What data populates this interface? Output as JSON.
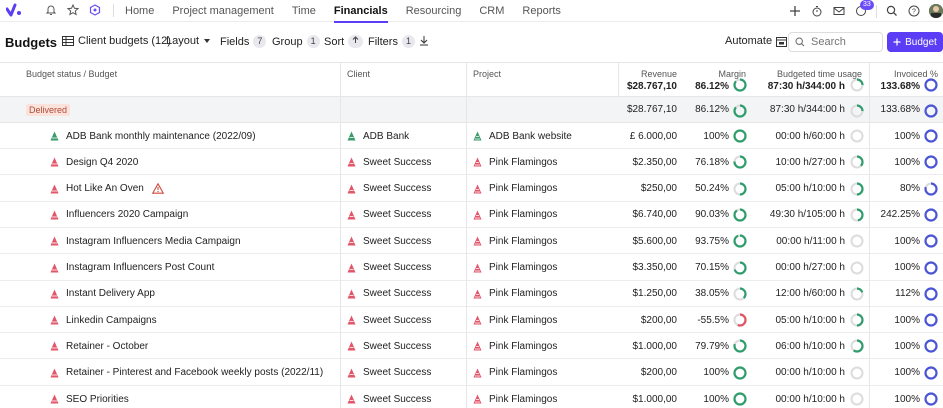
{
  "nav": {
    "items": [
      "Home",
      "Project management",
      "Time",
      "Financials",
      "Resourcing",
      "CRM",
      "Reports"
    ],
    "notification_count": "33"
  },
  "toolbar": {
    "title": "Budgets",
    "client_budgets": "Client budgets (12)",
    "layout": "Layout",
    "fields": "Fields",
    "fields_count": "7",
    "group": "Group",
    "group_count": "1",
    "sort": "Sort",
    "filters": "Filters",
    "filters_count": "1",
    "automate": "Automate",
    "search_placeholder": "Search",
    "add_budget": "Budget"
  },
  "table": {
    "columns": {
      "budget": "Budget status / Budget",
      "client": "Client",
      "project": "Project",
      "revenue": "Revenue",
      "margin": "Margin",
      "time": "Budgeted time usage",
      "invoiced": "Invoiced %"
    },
    "totals": {
      "revenue": "$28.767,10",
      "margin": "86.12%",
      "time": "87:30 h/344:00 h",
      "invoiced": "133.68%"
    },
    "group": {
      "label": "Delivered",
      "revenue": "$28.767,10",
      "margin": "86.12%",
      "time": "87:30 h/344:00 h",
      "invoiced": "133.68%",
      "margin_ring": 0.86,
      "time_ring": 0.25,
      "invoiced_ring": 1.0
    },
    "rows": [
      {
        "budget": "ADB Bank monthly maintenance (2022/09)",
        "client": "ADB Bank",
        "project": "ADB Bank website",
        "revenue": "£ 6.000,00",
        "margin": "100%",
        "time": "00:00 h/60:00 h",
        "invoiced": "100%",
        "margin_ring": 1.0,
        "time_ring": 0.0,
        "invoiced_ring": 1.0,
        "color": "#3a9a6a",
        "warn": false
      },
      {
        "budget": "Design Q4 2020",
        "client": "Sweet Success",
        "project": "Pink Flamingos",
        "revenue": "$2.350,00",
        "margin": "76.18%",
        "time": "10:00 h/27:00 h",
        "invoiced": "100%",
        "margin_ring": 0.76,
        "time_ring": 0.37,
        "invoiced_ring": 1.0,
        "color": "#e2566a",
        "warn": false
      },
      {
        "budget": "Hot Like An Oven",
        "client": "Sweet Success",
        "project": "Pink Flamingos",
        "revenue": "$250,00",
        "margin": "50.24%",
        "time": "05:00 h/10:00 h",
        "invoiced": "80%",
        "margin_ring": 0.5,
        "time_ring": 0.5,
        "invoiced_ring": 0.8,
        "color": "#e2566a",
        "warn": true
      },
      {
        "budget": "Influencers 2020 Campaign",
        "client": "Sweet Success",
        "project": "Pink Flamingos",
        "revenue": "$6.740,00",
        "margin": "90.03%",
        "time": "49:30 h/105:00 h",
        "invoiced": "242.25%",
        "margin_ring": 0.9,
        "time_ring": 0.47,
        "invoiced_ring": 1.0,
        "color": "#e2566a",
        "warn": false
      },
      {
        "budget": "Instagram Influencers Media Campaign",
        "client": "Sweet Success",
        "project": "Pink Flamingos",
        "revenue": "$5.600,00",
        "margin": "93.75%",
        "time": "00:00 h/11:00 h",
        "invoiced": "100%",
        "margin_ring": 0.94,
        "time_ring": 0.0,
        "invoiced_ring": 1.0,
        "color": "#e2566a",
        "warn": false
      },
      {
        "budget": "Instagram Influencers Post Count",
        "client": "Sweet Success",
        "project": "Pink Flamingos",
        "revenue": "$3.350,00",
        "margin": "70.15%",
        "time": "00:00 h/27:00 h",
        "invoiced": "100%",
        "margin_ring": 0.7,
        "time_ring": 0.0,
        "invoiced_ring": 1.0,
        "color": "#e2566a",
        "warn": false
      },
      {
        "budget": "Instant Delivery App",
        "client": "Sweet Success",
        "project": "Pink Flamingos",
        "revenue": "$1.250,00",
        "margin": "38.05%",
        "time": "12:00 h/60:00 h",
        "invoiced": "112%",
        "margin_ring": 0.38,
        "time_ring": 0.2,
        "invoiced_ring": 1.0,
        "color": "#e2566a",
        "warn": false
      },
      {
        "budget": "Linkedin Campaigns",
        "client": "Sweet Success",
        "project": "Pink Flamingos",
        "revenue": "$200,00",
        "margin": "-55.5%",
        "time": "05:00 h/10:00 h",
        "invoiced": "100%",
        "margin_ring": 0.56,
        "time_ring": 0.5,
        "invoiced_ring": 1.0,
        "color": "#e2566a",
        "warn": false,
        "negative": true
      },
      {
        "budget": "Retainer - October",
        "client": "Sweet Success",
        "project": "Pink Flamingos",
        "revenue": "$1.000,00",
        "margin": "79.79%",
        "time": "06:00 h/10:00 h",
        "invoiced": "100%",
        "margin_ring": 0.8,
        "time_ring": 0.6,
        "invoiced_ring": 1.0,
        "color": "#e2566a",
        "warn": false
      },
      {
        "budget": "Retainer - Pinterest and Facebook weekly posts (2022/11)",
        "client": "Sweet Success",
        "project": "Pink Flamingos",
        "revenue": "$200,00",
        "margin": "100%",
        "time": "00:00 h/10:00 h",
        "invoiced": "100%",
        "margin_ring": 1.0,
        "time_ring": 0.0,
        "invoiced_ring": 1.0,
        "color": "#e2566a",
        "warn": false
      },
      {
        "budget": "SEO Priorities",
        "client": "Sweet Success",
        "project": "Pink Flamingos",
        "revenue": "$1.000,00",
        "margin": "100%",
        "time": "00:00 h/10:00 h",
        "invoiced": "100%",
        "margin_ring": 1.0,
        "time_ring": 0.0,
        "invoiced_ring": 1.0,
        "color": "#e2566a",
        "warn": false
      }
    ]
  },
  "colors": {
    "accent": "#5b3df5",
    "ring_green": "#2e9d6b",
    "ring_red": "#e05260",
    "ring_blue": "#4a55d6",
    "ring_track": "#dcdcdc"
  }
}
